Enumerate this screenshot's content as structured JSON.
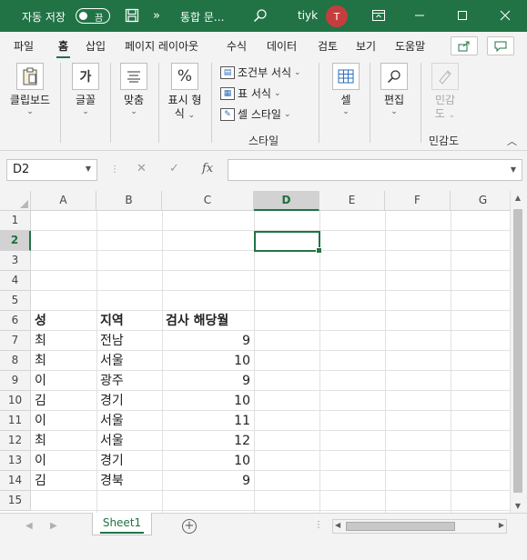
{
  "titlebar": {
    "autosave_label": "자동 저장",
    "autosave_toggle": "끔",
    "save_icon": "save-icon",
    "overflow_icon": "»",
    "document_title": "통합 문...",
    "search_icon": "search-icon",
    "user_name": "tiyk",
    "avatar_initial": "T",
    "accent_color": "#217346",
    "avatar_color": "#c43e3e"
  },
  "tabs": {
    "items": [
      "파일",
      "홈",
      "삽입",
      "페이지 레이아웃",
      "수식",
      "데이터",
      "검토",
      "보기",
      "도움말"
    ],
    "active": "홈"
  },
  "ribbon": {
    "clipboard": "클립보드",
    "font": "글꼴",
    "align": "맞춤",
    "number_line1": "표시 형",
    "number_line2": "식",
    "cond_format": "조건부 서식",
    "table_format": "표 서식",
    "cell_styles": "셀 스타일",
    "styles_group": "스타일",
    "cells": "셀",
    "editing": "편집",
    "sensitivity_line1": "민감",
    "sensitivity_line2": "도",
    "sensitivity_group": "민감도",
    "font_icon_glyph": "가",
    "number_icon_glyph": "%"
  },
  "formulabar": {
    "name_box": "D2",
    "cancel_glyph": "✕",
    "enter_glyph": "✓",
    "fx_glyph": "fx",
    "formula": ""
  },
  "grid": {
    "columns": [
      "A",
      "B",
      "C",
      "D",
      "E",
      "F",
      "G"
    ],
    "selected_column": "D",
    "rows": [
      "1",
      "2",
      "3",
      "4",
      "5",
      "6",
      "7",
      "8",
      "9",
      "10",
      "11",
      "12",
      "13",
      "14",
      "15"
    ],
    "selected_row": "2",
    "selected_cell": "D2",
    "header": {
      "a": "성",
      "b": "지역",
      "c": "검사 해당월"
    },
    "data": [
      {
        "a": "최",
        "b": "전남",
        "c": "9"
      },
      {
        "a": "최",
        "b": "서울",
        "c": "10"
      },
      {
        "a": "이",
        "b": "광주",
        "c": "9"
      },
      {
        "a": "김",
        "b": "경기",
        "c": "10"
      },
      {
        "a": "이",
        "b": "서울",
        "c": "11"
      },
      {
        "a": "최",
        "b": "서울",
        "c": "12"
      },
      {
        "a": "이",
        "b": "경기",
        "c": "10"
      },
      {
        "a": "김",
        "b": "경북",
        "c": "9"
      }
    ]
  },
  "sheets": {
    "tabs": [
      "Sheet1"
    ],
    "active": "Sheet1",
    "add_glyph": "+"
  }
}
